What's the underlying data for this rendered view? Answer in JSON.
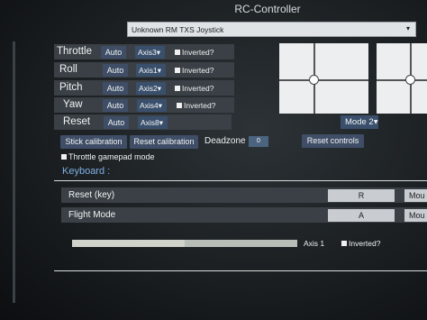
{
  "window": {
    "title": "RC-Controller"
  },
  "device": {
    "selected": "Unknown RM TXS Joystick"
  },
  "axes": [
    {
      "name": "Throttle",
      "mode": "Auto",
      "axis": "Axis3",
      "inverted_label": "Inverted?",
      "inverted": true
    },
    {
      "name": "Roll",
      "mode": "Auto",
      "axis": "Axis1",
      "inverted_label": "Inverted?",
      "inverted": true
    },
    {
      "name": "Pitch",
      "mode": "Auto",
      "axis": "Axis2",
      "inverted_label": "Inverted?",
      "inverted": true
    },
    {
      "name": "Yaw",
      "mode": "Auto",
      "axis": "Axis4",
      "inverted_label": "Inverted?",
      "inverted": true
    },
    {
      "name": "Reset",
      "mode": "Auto",
      "axis": "Axis8"
    }
  ],
  "mode_select": {
    "value": "Mode 2"
  },
  "buttons": {
    "stick_calibration": "Stick calibration",
    "reset_calibration": "Reset calibration",
    "reset_controls": "Reset controls"
  },
  "deadzone": {
    "label": "Deadzone :",
    "value": "0"
  },
  "throttle_gamepad_mode": {
    "label": "Throttle gamepad mode",
    "checked": true
  },
  "keyboard": {
    "section_label": "Keyboard :",
    "rows": [
      {
        "label": "Reset (key)",
        "key": "R",
        "extra": "Mou"
      },
      {
        "label": "Flight Mode",
        "key": "A",
        "extra": "Mou"
      }
    ]
  },
  "axis_monitor": {
    "axis_label": "Axis 1",
    "inverted_label": "Inverted?",
    "level_percent": 50
  },
  "icons": {
    "dropdown_arrow": "chevron-down-icon",
    "checkbox": "checkbox-icon"
  }
}
